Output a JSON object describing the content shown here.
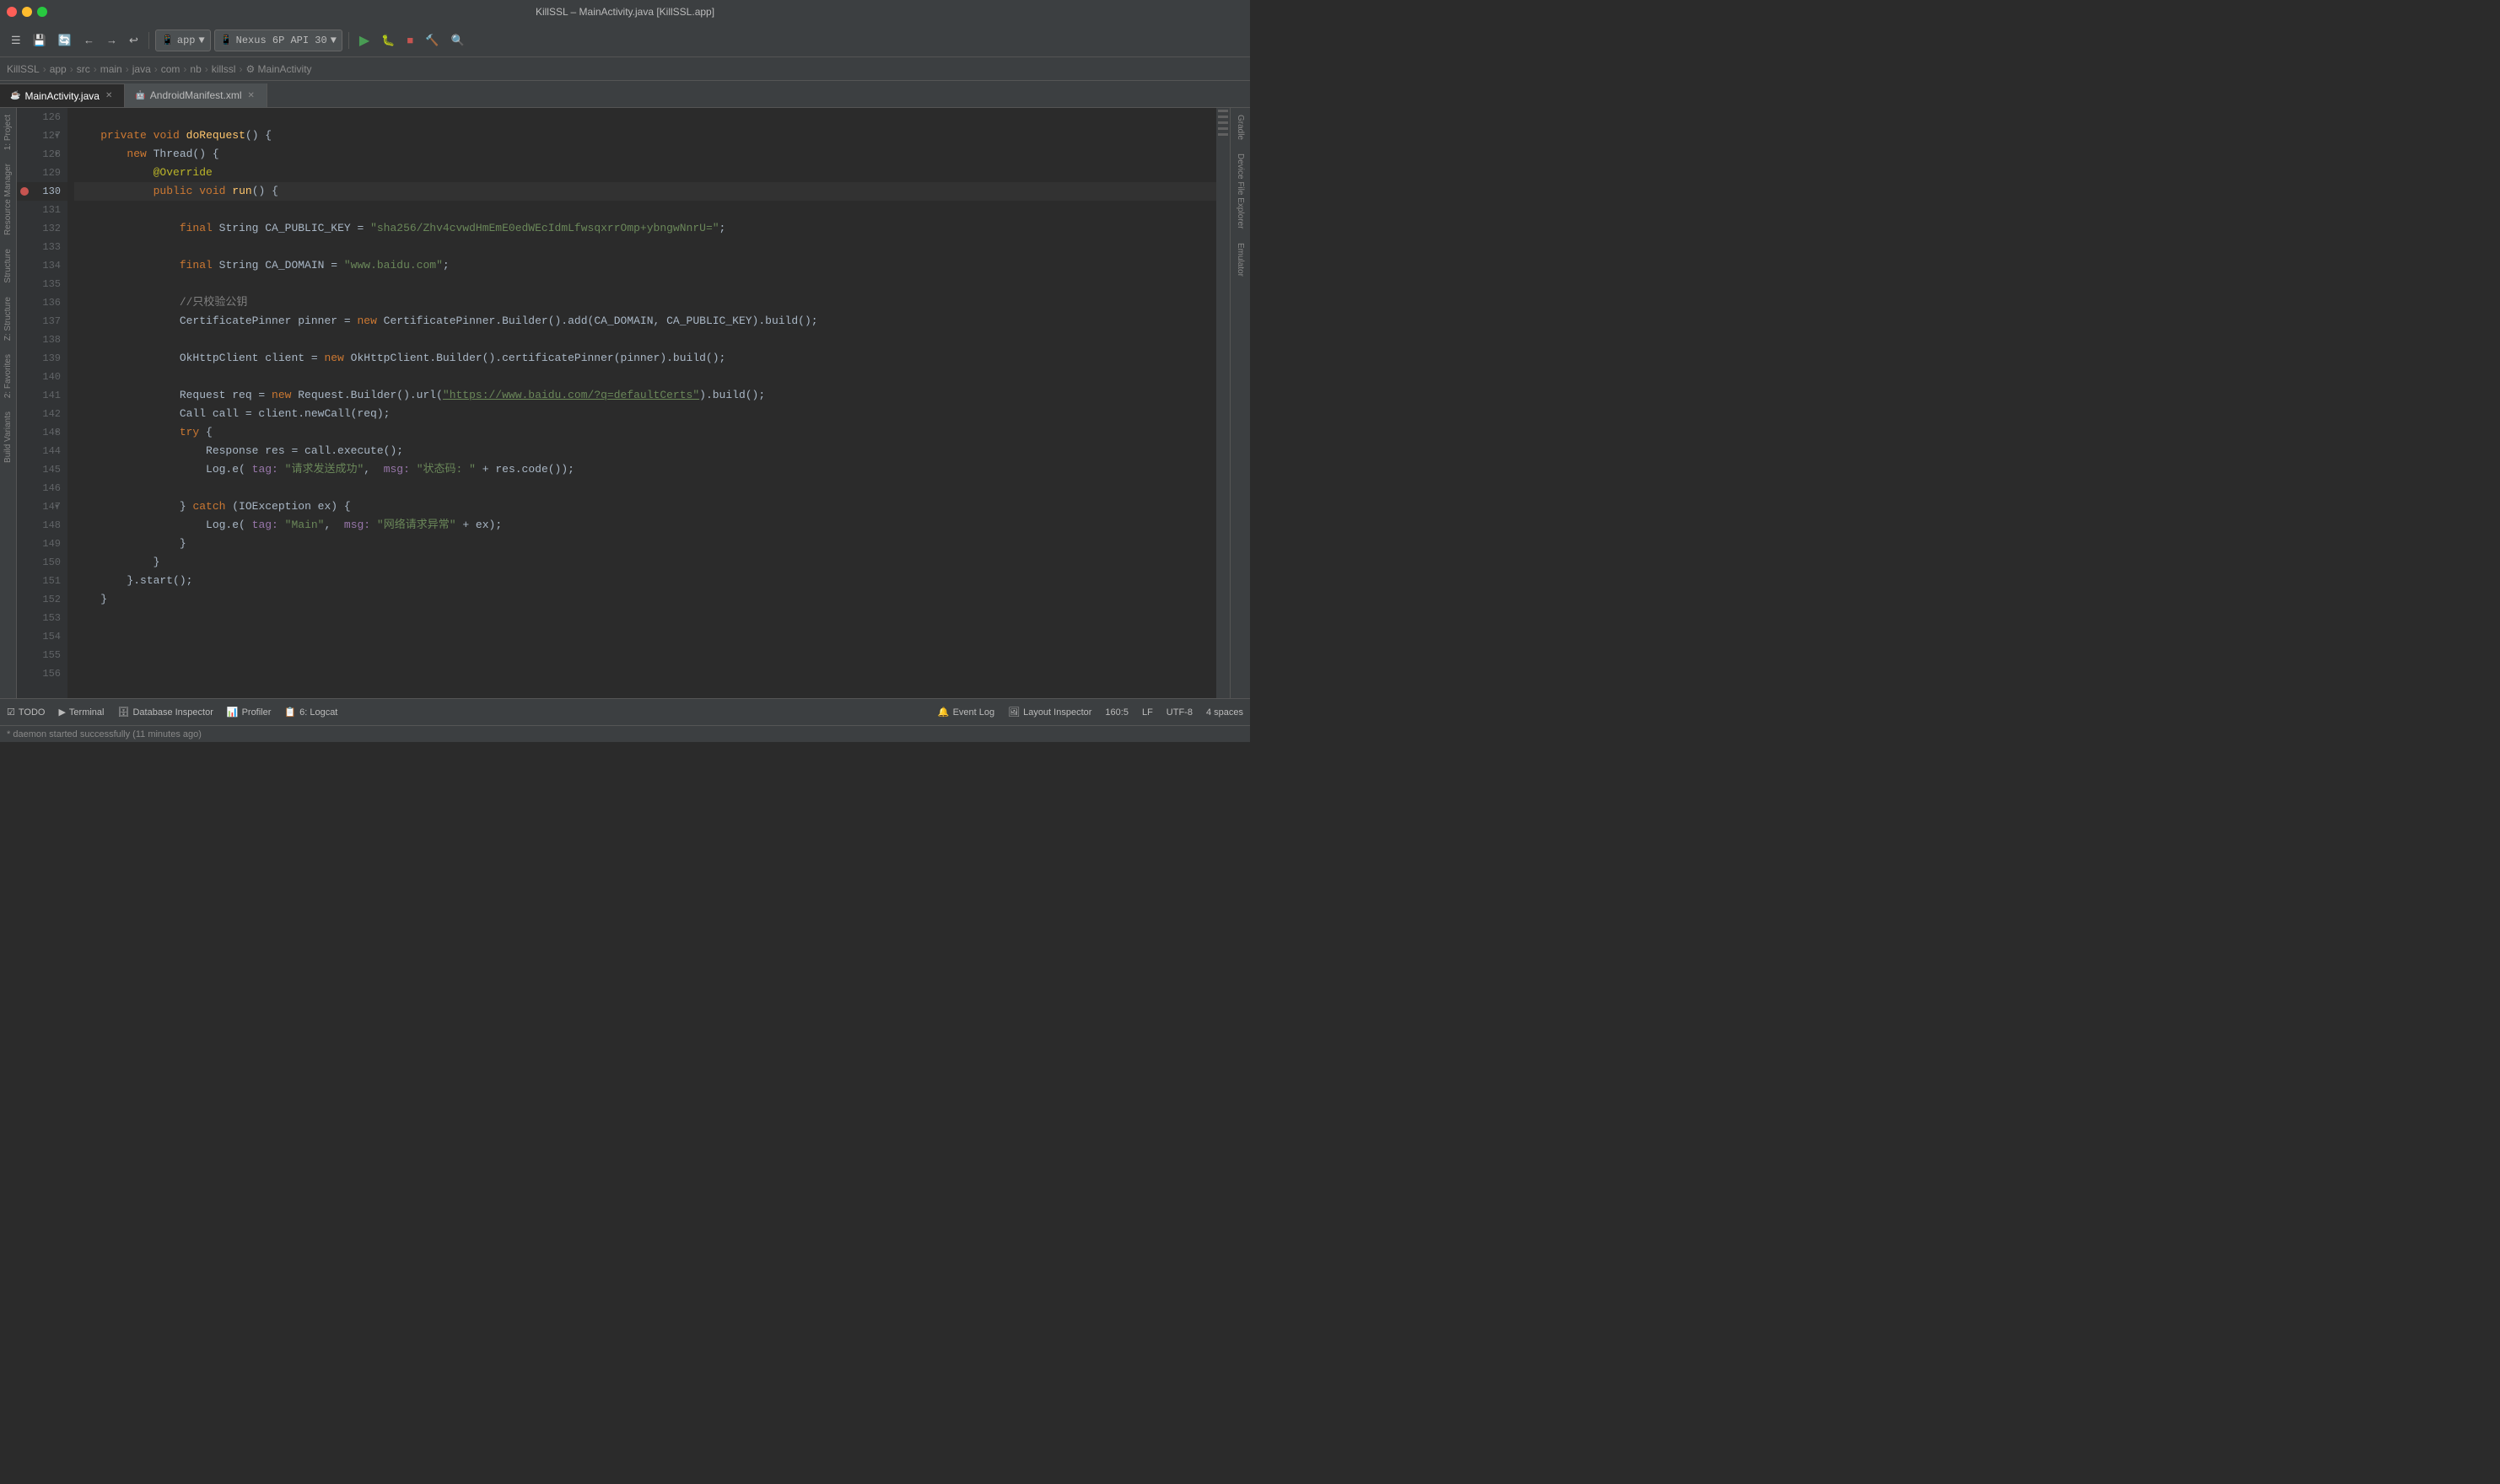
{
  "window": {
    "title": "KillSSL – MainActivity.java [KillSSL.app]"
  },
  "toolbar": {
    "app_label": "app",
    "device_label": "Nexus 6P API 30"
  },
  "breadcrumb": {
    "items": [
      "KillSSL",
      "app",
      "src",
      "main",
      "java",
      "com",
      "nb",
      "killssl",
      "MainActivity"
    ]
  },
  "tabs": [
    {
      "label": "MainActivity.java",
      "icon": "☕",
      "active": true
    },
    {
      "label": "AndroidManifest.xml",
      "icon": "🤖",
      "active": false
    }
  ],
  "left_sidebar": {
    "items": [
      "Project",
      "Resource Manager",
      "Structure",
      "Z: Structure",
      "Favorites",
      "Build Variants"
    ]
  },
  "right_sidebar": {
    "items": [
      "Gradle",
      "Device File Explorer",
      "Emulator"
    ]
  },
  "code": {
    "lines": [
      {
        "num": 126,
        "content": ""
      },
      {
        "num": 127,
        "content": "    private void doRequest() {",
        "tokens": [
          {
            "text": "    ",
            "cls": "plain"
          },
          {
            "text": "private",
            "cls": "kw"
          },
          {
            "text": " ",
            "cls": "plain"
          },
          {
            "text": "void",
            "cls": "kw"
          },
          {
            "text": " ",
            "cls": "plain"
          },
          {
            "text": "doRequest",
            "cls": "method"
          },
          {
            "text": "() {",
            "cls": "plain"
          }
        ]
      },
      {
        "num": 128,
        "content": "        new Thread() {",
        "tokens": [
          {
            "text": "        ",
            "cls": "plain"
          },
          {
            "text": "new",
            "cls": "kw"
          },
          {
            "text": " Thread() {",
            "cls": "plain"
          }
        ]
      },
      {
        "num": 129,
        "content": "            @Override",
        "tokens": [
          {
            "text": "            ",
            "cls": "plain"
          },
          {
            "text": "@Override",
            "cls": "annotation"
          }
        ]
      },
      {
        "num": 130,
        "content": "            public void run() {",
        "breakpoint": true,
        "tokens": [
          {
            "text": "            ",
            "cls": "plain"
          },
          {
            "text": "public",
            "cls": "kw"
          },
          {
            "text": " ",
            "cls": "plain"
          },
          {
            "text": "void",
            "cls": "kw"
          },
          {
            "text": " ",
            "cls": "plain"
          },
          {
            "text": "run",
            "cls": "method"
          },
          {
            "text": "() {",
            "cls": "plain"
          }
        ]
      },
      {
        "num": 131,
        "content": ""
      },
      {
        "num": 132,
        "content": "                final String CA_PUBLIC_KEY = \"sha256/Zhv4cvwdHmEmE0edWEcIdmLfwsqxrrOmp+ybngwNnrU=\";",
        "tokens": [
          {
            "text": "                ",
            "cls": "plain"
          },
          {
            "text": "final",
            "cls": "kw"
          },
          {
            "text": " String CA_PUBLIC_KEY = ",
            "cls": "plain"
          },
          {
            "text": "\"sha256/Zhv4cvwdHmEmE0edWEcIdmLfwsqxrrOmp+ybngwNnrU=\"",
            "cls": "string"
          },
          {
            "text": ";",
            "cls": "plain"
          }
        ]
      },
      {
        "num": 133,
        "content": ""
      },
      {
        "num": 134,
        "content": "                final String CA_DOMAIN = \"www.baidu.com\";",
        "tokens": [
          {
            "text": "                ",
            "cls": "plain"
          },
          {
            "text": "final",
            "cls": "kw"
          },
          {
            "text": " String CA_DOMAIN = ",
            "cls": "plain"
          },
          {
            "text": "\"www.baidu.com\"",
            "cls": "string"
          },
          {
            "text": ";",
            "cls": "plain"
          }
        ]
      },
      {
        "num": 135,
        "content": ""
      },
      {
        "num": 136,
        "content": "                //只校验公钥",
        "tokens": [
          {
            "text": "                ",
            "cls": "plain"
          },
          {
            "text": "//只校验公钥",
            "cls": "comment"
          }
        ]
      },
      {
        "num": 137,
        "content": "                CertificatePinner pinner = new CertificatePinner.Builder().add(CA_DOMAIN, CA_PUBLIC_KEY).build();",
        "tokens": [
          {
            "text": "                CertificatePinner pinner = ",
            "cls": "plain"
          },
          {
            "text": "new",
            "cls": "kw"
          },
          {
            "text": " CertificatePinner.Builder().add(CA_DOMAIN, CA_PUBLIC_KEY).build();",
            "cls": "plain"
          }
        ]
      },
      {
        "num": 138,
        "content": ""
      },
      {
        "num": 139,
        "content": "                OkHttpClient client = new OkHttpClient.Builder().certificatePinner(pinner).build();",
        "tokens": [
          {
            "text": "                OkHttpClient client = ",
            "cls": "plain"
          },
          {
            "text": "new",
            "cls": "kw"
          },
          {
            "text": " OkHttpClient.Builder().certificatePinner(pinner).build();",
            "cls": "plain"
          }
        ]
      },
      {
        "num": 140,
        "content": ""
      },
      {
        "num": 141,
        "content": "                Request req = new Request.Builder().url(\"https://www.baidu.com/?q=defaultCerts\").build();",
        "tokens": [
          {
            "text": "                Request req = ",
            "cls": "plain"
          },
          {
            "text": "new",
            "cls": "kw"
          },
          {
            "text": " Request.Builder().url(",
            "cls": "plain"
          },
          {
            "text": "\"https://www.baidu.com/?q=defaultCerts\"",
            "cls": "url"
          },
          {
            "text": ").build();",
            "cls": "plain"
          }
        ]
      },
      {
        "num": 142,
        "content": "                Call call = client.newCall(req);",
        "tokens": [
          {
            "text": "                Call call = client.newCall(req);",
            "cls": "plain"
          }
        ]
      },
      {
        "num": 143,
        "content": "                try {",
        "tokens": [
          {
            "text": "                ",
            "cls": "plain"
          },
          {
            "text": "try",
            "cls": "kw"
          },
          {
            "text": " {",
            "cls": "plain"
          }
        ]
      },
      {
        "num": 144,
        "content": "                    Response res = call.execute();",
        "tokens": [
          {
            "text": "                    Response res = call.execute();",
            "cls": "plain"
          }
        ]
      },
      {
        "num": 145,
        "content": "                    Log.e( tag: \"请求发送成功\",  msg: \"状态码: \" + res.code());",
        "tokens": [
          {
            "text": "                    Log.e( ",
            "cls": "plain"
          },
          {
            "text": "tag:",
            "cls": "param-label"
          },
          {
            "text": " ",
            "cls": "plain"
          },
          {
            "text": "\"请求发送成功\"",
            "cls": "string"
          },
          {
            "text": ",  ",
            "cls": "plain"
          },
          {
            "text": "msg:",
            "cls": "param-label"
          },
          {
            "text": " ",
            "cls": "plain"
          },
          {
            "text": "\"状态码: \"",
            "cls": "string"
          },
          {
            "text": " + res.code());",
            "cls": "plain"
          }
        ]
      },
      {
        "num": 146,
        "content": ""
      },
      {
        "num": 147,
        "content": "                } catch (IOException ex) {",
        "tokens": [
          {
            "text": "                } ",
            "cls": "plain"
          },
          {
            "text": "catch",
            "cls": "kw"
          },
          {
            "text": " (IOException ex) {",
            "cls": "plain"
          }
        ]
      },
      {
        "num": 148,
        "content": "                    Log.e( tag: \"Main\",  msg: \"网络请求异常\" + ex);",
        "tokens": [
          {
            "text": "                    Log.e( ",
            "cls": "plain"
          },
          {
            "text": "tag:",
            "cls": "param-label"
          },
          {
            "text": " ",
            "cls": "plain"
          },
          {
            "text": "\"Main\"",
            "cls": "string"
          },
          {
            "text": ",  ",
            "cls": "plain"
          },
          {
            "text": "msg:",
            "cls": "param-label"
          },
          {
            "text": " ",
            "cls": "plain"
          },
          {
            "text": "\"网络请求异常\"",
            "cls": "string"
          },
          {
            "text": " + ex);",
            "cls": "plain"
          }
        ]
      },
      {
        "num": 149,
        "content": "                }",
        "tokens": [
          {
            "text": "                }",
            "cls": "plain"
          }
        ]
      },
      {
        "num": 150,
        "content": "            }",
        "tokens": [
          {
            "text": "            }",
            "cls": "plain"
          }
        ]
      },
      {
        "num": 151,
        "content": "        }.start();",
        "tokens": [
          {
            "text": "        }.start();",
            "cls": "plain"
          }
        ]
      },
      {
        "num": 152,
        "content": "    }",
        "tokens": [
          {
            "text": "    }",
            "cls": "plain"
          }
        ]
      },
      {
        "num": 153,
        "content": ""
      },
      {
        "num": 154,
        "content": ""
      },
      {
        "num": 155,
        "content": ""
      },
      {
        "num": 156,
        "content": ""
      }
    ]
  },
  "status_bar": {
    "todo_label": "TODO",
    "terminal_label": "Terminal",
    "database_inspector_label": "Database Inspector",
    "profiler_label": "Profiler",
    "logcat_label": "6: Logcat",
    "event_log_label": "Event Log",
    "layout_inspector_label": "Layout Inspector",
    "cursor_position": "160:5",
    "line_endings": "LF",
    "encoding": "UTF-8",
    "indent": "4 spaces"
  },
  "status_bottom": {
    "message": "* daemon started successfully (11 minutes ago)"
  }
}
